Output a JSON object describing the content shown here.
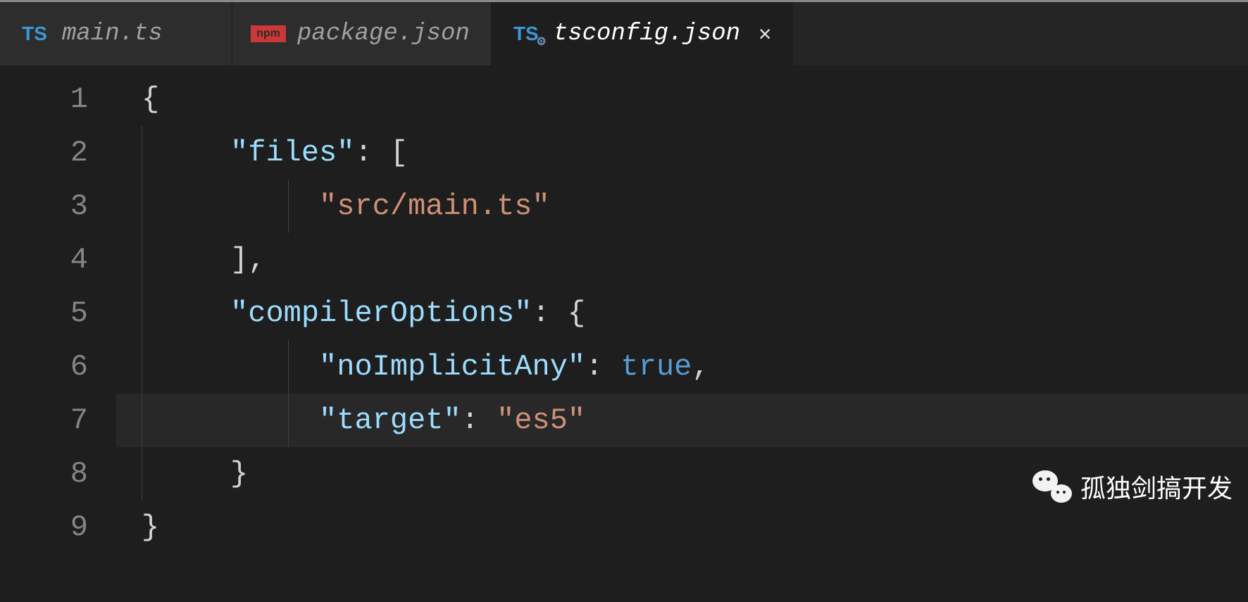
{
  "tabs": [
    {
      "label": "main.ts",
      "icon": "ts",
      "active": false
    },
    {
      "label": "package.json",
      "icon": "npm",
      "active": false
    },
    {
      "label": "tsconfig.json",
      "icon": "ts-gear",
      "active": true,
      "closeable": true
    }
  ],
  "lineNumbers": [
    "1",
    "2",
    "3",
    "4",
    "5",
    "6",
    "7",
    "8",
    "9"
  ],
  "code": {
    "l1": {
      "brace": "{"
    },
    "l2": {
      "key": "\"files\"",
      "punct1": ": ["
    },
    "l3": {
      "string": "\"src/main.ts\""
    },
    "l4": {
      "bracket": "],",
      "punctEnd": ""
    },
    "l5": {
      "key": "\"compilerOptions\"",
      "punct1": ": {"
    },
    "l6": {
      "key": "\"noImplicitAny\"",
      "punct1": ": ",
      "bool": "true",
      "punct2": ","
    },
    "l7": {
      "key": "\"target\"",
      "punct1": ": ",
      "string": "\"es5\""
    },
    "l8": {
      "brace": "}"
    },
    "l9": {
      "brace": "}"
    }
  },
  "icons": {
    "ts_label": "TS",
    "npm_label": "npm"
  },
  "watermark": {
    "text": "孤独剑搞开发"
  }
}
